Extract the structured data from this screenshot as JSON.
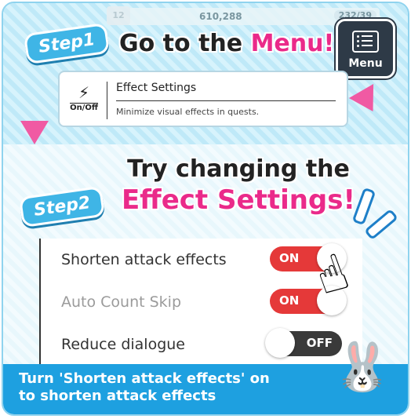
{
  "hud": {
    "level": "12",
    "coins": "610,288",
    "stamina": "232/39"
  },
  "step1": {
    "badge": "Step1",
    "title_prefix": "Go to the ",
    "title_highlight": "Menu!"
  },
  "menu_button": {
    "label": "Menu"
  },
  "effect_card": {
    "icon_label": "On/Off",
    "title": "Effect Settings",
    "description": "Minimize visual effects in quests."
  },
  "step2": {
    "badge": "Step2",
    "title_line1": "Try changing the",
    "title_line2": "Effect Settings!"
  },
  "settings": {
    "rows": [
      {
        "label": "Shorten attack effects",
        "state": "ON"
      },
      {
        "label": "Auto Count Skip",
        "state": "ON"
      },
      {
        "label": "Reduce dialogue",
        "state": "OFF"
      }
    ]
  },
  "footer": {
    "line1": "Turn 'Shorten attack effects' on",
    "line2": "to shorten attack effects"
  },
  "colors": {
    "accent_pink": "#ea2a8a",
    "toggle_on": "#e53939",
    "toggle_off": "#3a3a3a",
    "footer_blue": "#1ea0e0"
  }
}
